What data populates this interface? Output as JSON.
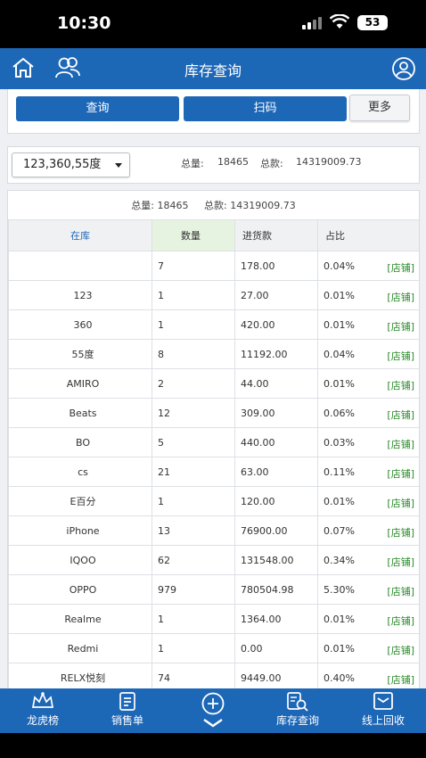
{
  "status_bar": {
    "time": "10:30",
    "battery": "53"
  },
  "header": {
    "title": "库存查询",
    "icons": [
      "home-icon",
      "users-icon",
      "profile-icon"
    ]
  },
  "actions": {
    "query": "查询",
    "scan": "扫码",
    "more": "更多"
  },
  "filter": {
    "selected": "123,360,55度",
    "total_qty_label": "总量:",
    "total_qty": "18465",
    "total_amount_label": "总款:",
    "total_amount": "14319009.73"
  },
  "table": {
    "total_qty_label": "总量:",
    "total_qty": "18465",
    "total_amount_label": "总款:",
    "total_amount": "14319009.73",
    "columns": [
      "在库",
      "数量",
      "进货款",
      "占比"
    ],
    "shop_link": "[店铺]",
    "rows": [
      {
        "name": "",
        "qty": "7",
        "cost": "178.00",
        "share": "0.04%"
      },
      {
        "name": "123",
        "qty": "1",
        "cost": "27.00",
        "share": "0.01%"
      },
      {
        "name": "360",
        "qty": "1",
        "cost": "420.00",
        "share": "0.01%"
      },
      {
        "name": "55度",
        "qty": "8",
        "cost": "11192.00",
        "share": "0.04%"
      },
      {
        "name": "AMIRO",
        "qty": "2",
        "cost": "44.00",
        "share": "0.01%"
      },
      {
        "name": "Beats",
        "qty": "12",
        "cost": "309.00",
        "share": "0.06%"
      },
      {
        "name": "BO",
        "qty": "5",
        "cost": "440.00",
        "share": "0.03%"
      },
      {
        "name": "cs",
        "qty": "21",
        "cost": "63.00",
        "share": "0.11%"
      },
      {
        "name": "E百分",
        "qty": "1",
        "cost": "120.00",
        "share": "0.01%"
      },
      {
        "name": "iPhone",
        "qty": "13",
        "cost": "76900.00",
        "share": "0.07%"
      },
      {
        "name": "IQOO",
        "qty": "62",
        "cost": "131548.00",
        "share": "0.34%"
      },
      {
        "name": "OPPO",
        "qty": "979",
        "cost": "780504.98",
        "share": "5.30%"
      },
      {
        "name": "Realme",
        "qty": "1",
        "cost": "1364.00",
        "share": "0.01%"
      },
      {
        "name": "Redmi",
        "qty": "1",
        "cost": "0.00",
        "share": "0.01%"
      },
      {
        "name": "RELX悦刻",
        "qty": "74",
        "cost": "9449.00",
        "share": "0.40%"
      }
    ]
  },
  "bottom_nav": {
    "items": [
      {
        "label": "龙虎榜",
        "icon": "crown-icon"
      },
      {
        "label": "销售单",
        "icon": "receipt-icon"
      },
      {
        "label": "",
        "icon": "plus-circle-icon"
      },
      {
        "label": "库存查询",
        "icon": "inventory-search-icon"
      },
      {
        "label": "线上回收",
        "icon": "mail-icon"
      }
    ]
  },
  "colors": {
    "primary": "#1d67b7",
    "shop_link": "#2b8a2b",
    "qty_header_bg": "#e7f3e1"
  }
}
